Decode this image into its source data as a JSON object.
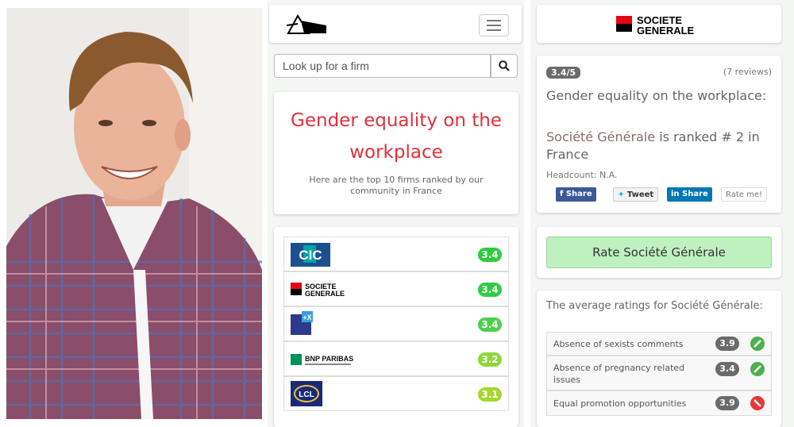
{
  "search": {
    "placeholder": "Look up for a firm"
  },
  "hero": {
    "title": "Gender equality on the workplace",
    "subtitle": "Here are the top 10 firms ranked by our community in France"
  },
  "ranking": [
    {
      "logo_text": "CIC",
      "score": "3.4",
      "color": "#2ecc40"
    },
    {
      "logo_text": "SOCIETE GENERALE",
      "score": "3.4",
      "color": "#2ecc40"
    },
    {
      "logo_text": "+X",
      "score": "3.4",
      "color": "#4cd04c"
    },
    {
      "logo_text": "BNP PARIBAS",
      "score": "3.2",
      "color": "#8fd63a"
    },
    {
      "logo_text": "LCL",
      "score": "3.1",
      "color": "#a6d630"
    }
  ],
  "firm": {
    "brand_line1": "SOCIETE",
    "brand_line2": "GENERALE",
    "rating_badge": "3.4/5",
    "reviews": "(7 reviews)",
    "heading": "Gender equality on the workplace:",
    "name": "Société Générale",
    "rank_text": " is ranked # 2 in France",
    "headcount": "Headcount: N.A.",
    "share_fb": "Share",
    "share_tw": "Tweet",
    "share_li": "Share",
    "rate_me": "Rate me!",
    "rate_button": "Rate Société Générale"
  },
  "averages": {
    "title": "The average ratings for Société Générale:",
    "items": [
      {
        "label": "Absence of sexists comments",
        "score": "3.9",
        "icon": "pencil-green-icon"
      },
      {
        "label": "Absence of pregnancy related issues",
        "score": "3.4",
        "icon": "pencil-green-icon"
      },
      {
        "label": "Equal promotion opportunities",
        "score": "3.9",
        "icon": "no-red-icon"
      }
    ]
  }
}
